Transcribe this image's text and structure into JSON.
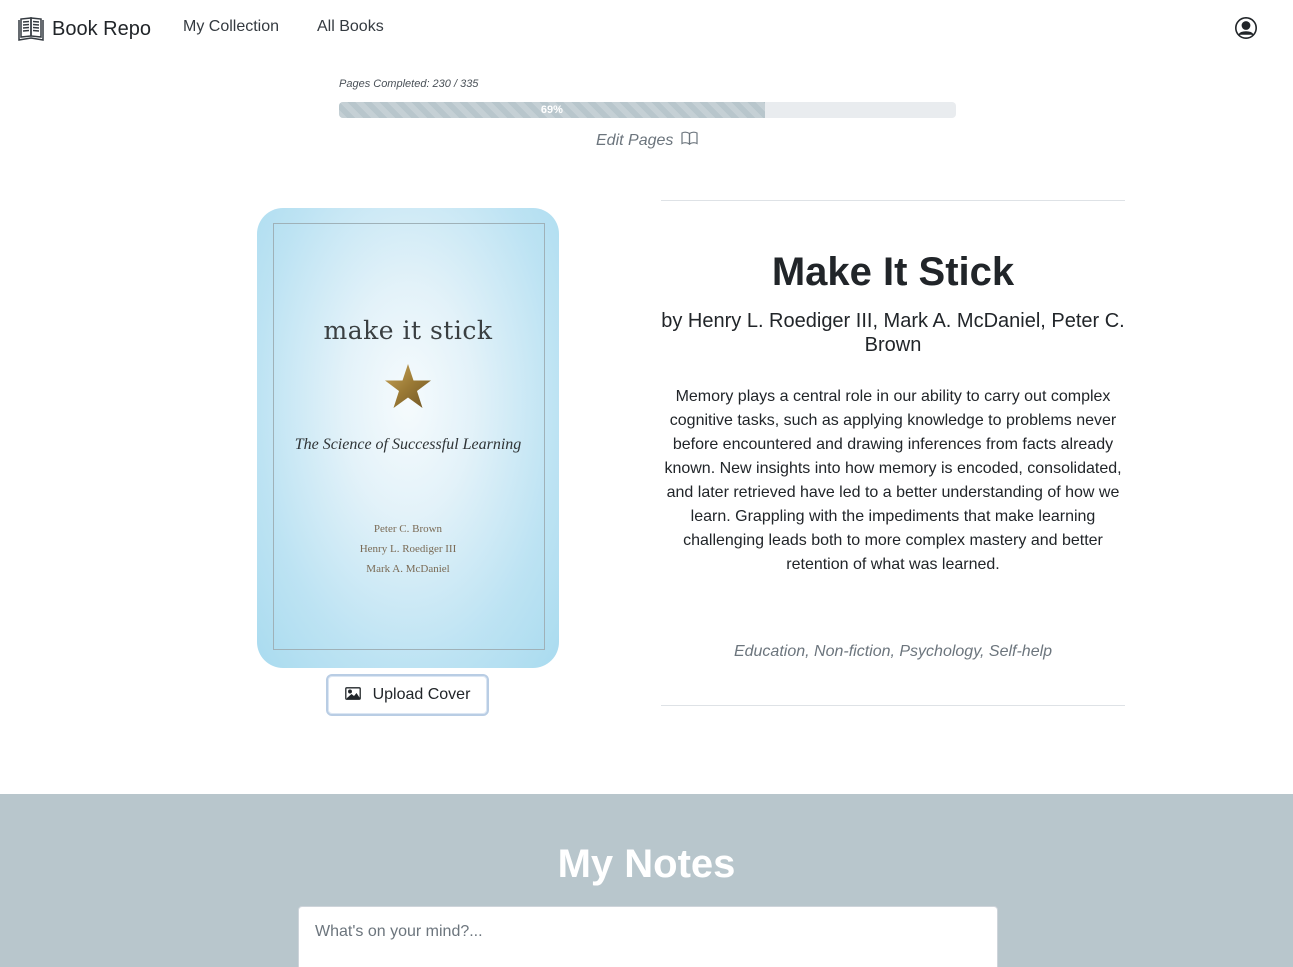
{
  "navbar": {
    "brand": "Book Repo",
    "brand_icon": "open-book-icon",
    "links": [
      "My Collection",
      "All Books"
    ],
    "profile_icon": "user-circle-icon"
  },
  "progress": {
    "label": "Pages Completed: 230 / 335",
    "pages_read": 230,
    "pages_total": 335,
    "percent": 0.69,
    "percent_text": "69%",
    "edit_label": "Edit Pages",
    "edit_icon": "book-icon"
  },
  "cover": {
    "title": "make it stick",
    "subtitle": "The Science of Successful Learning",
    "authors": [
      "Peter C. Brown",
      "Henry L. Roediger III",
      "Mark A. McDaniel"
    ],
    "star_icon": "star-icon",
    "upload_label": "Upload Cover",
    "upload_icon": "image-icon"
  },
  "book": {
    "title": "Make It Stick",
    "authors": "by Henry L. Roediger III, Mark A. McDaniel, Peter C. Brown",
    "description": "Memory plays a central role in our ability to carry out complex cognitive tasks, such as applying knowledge to problems never before encountered and drawing inferences from facts already known. New insights into how memory is encoded, consolidated, and later retrieved have led to a better understanding of how we learn. Grappling with the impediments that make learning challenging leads both to more complex mastery and better retention of what was learned.",
    "genres": "Education, Non-fiction, Psychology, Self-help"
  },
  "notes": {
    "title": "My Notes",
    "placeholder": "What's on your mind?..."
  },
  "colors": {
    "progress_fill": "#b8c6cc",
    "notes_background": "#b8c6cc",
    "cover_background": "#a9dbef",
    "upload_border": "#b9cde4"
  }
}
